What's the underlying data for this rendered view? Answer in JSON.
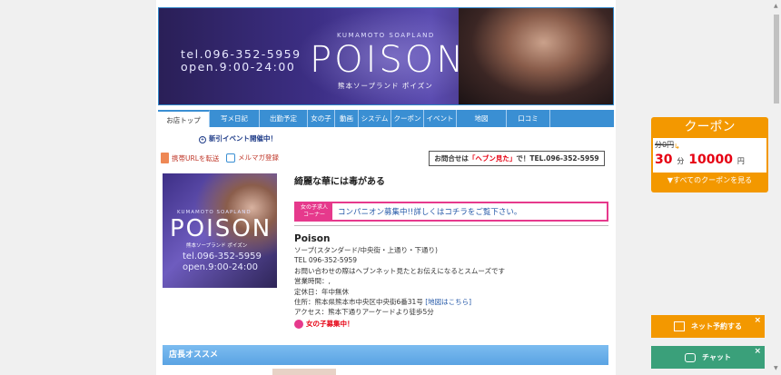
{
  "header": {
    "tel": "tel.096-352-5959",
    "hours": "open.9:00-24:00",
    "kumamoto": "KUMAMOTO SOAPLAND",
    "logo": "POISON",
    "subtitle": "熊本ソープランド ポイズン"
  },
  "nav": {
    "items": [
      {
        "label": "お店トップ"
      },
      {
        "label": "写メ日記"
      },
      {
        "label": "出勤予定"
      },
      {
        "label": "女の子"
      },
      {
        "label": "動画"
      },
      {
        "label": "システム"
      },
      {
        "label": "クーポン"
      },
      {
        "label": "イベント"
      },
      {
        "label": "地図"
      },
      {
        "label": "口コミ"
      },
      {
        "label": ""
      }
    ]
  },
  "event_link": "新引イベント開催中！",
  "links": {
    "mobile": "携帯URLを転送",
    "mail": "メルマガ登録"
  },
  "inquiry": {
    "prefix": "お問合せは",
    "highlight": "「ヘブン見た」",
    "suffix": "で！TEL.096-352-5959"
  },
  "shop": {
    "catchphrase": "綺麗な華には毒がある",
    "recruit_tag_1": "女の子求人",
    "recruit_tag_2": "コーナー",
    "recruit_message": "コンパニオン募集中!!詳しくはコチラをご覧下さい。",
    "name": "Poison",
    "category": "ソープ(スタンダード/中央街・上通り・下通り)",
    "tel": "TEL 096-352-5959",
    "note": "お問い合わせの際はヘブンネット見たとお伝えになるとスムーズです",
    "hours": "営業時間：,",
    "holiday": "定休日：年中無休",
    "address": "住所：熊本県熊本市中央区中央街6番31号",
    "map_link": "[地図はこちら]",
    "access": "アクセス：熊本下通りアーケードより徒歩5分",
    "girls_recruit": "女の子募集中！"
  },
  "staff_section": {
    "title": "店長オススメ"
  },
  "coupon": {
    "title": "クーポン",
    "old_price": "分0円",
    "minutes": "30",
    "minutes_unit": "分",
    "price": "10000",
    "price_unit": "円",
    "all_link": "▼すべてのクーポンを見る"
  },
  "floating": {
    "net_reserve": "ネット予約する",
    "chat": "チャット",
    "close": "×"
  },
  "colors": {
    "nav_blue": "#3a8fd3",
    "coupon_orange": "#f39800",
    "chat_green": "#3aa07a",
    "recruit_pink": "#e6398c"
  }
}
